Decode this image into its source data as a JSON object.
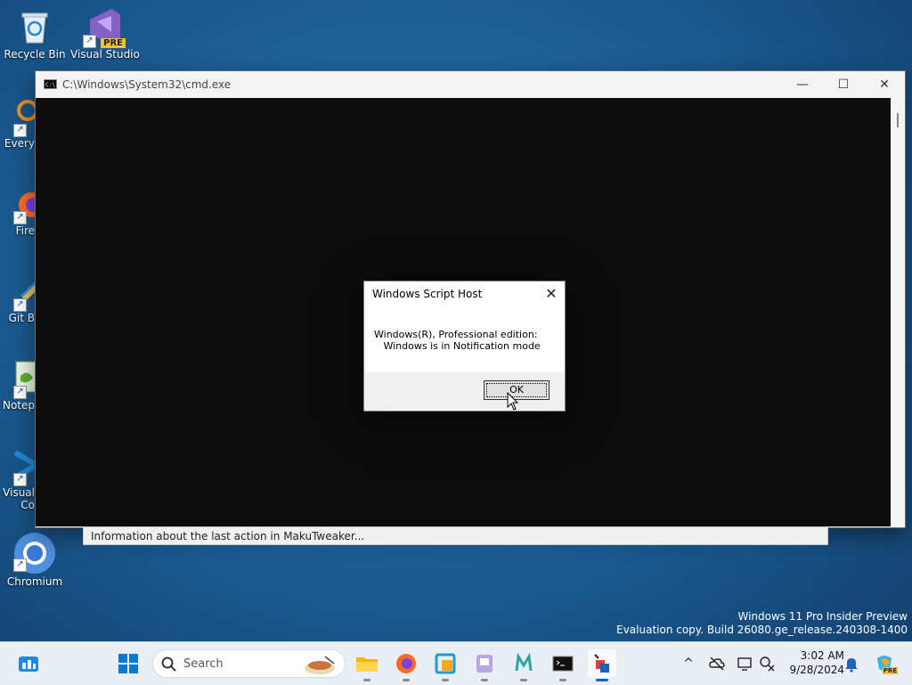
{
  "desktop": {
    "icons": [
      {
        "label": "Recycle Bin"
      },
      {
        "label": "Visual Studio",
        "badge": "PRE"
      },
      {
        "label": "Every"
      },
      {
        "label": "Fire"
      },
      {
        "label": "Git B"
      },
      {
        "label": "Notep"
      },
      {
        "label": "Visual",
        "label2": "Co"
      },
      {
        "label": "Chromium"
      }
    ]
  },
  "cmd": {
    "title": "C:\\Windows\\System32\\cmd.exe",
    "icon_text": "C:\\",
    "controls": {
      "minimize": "—",
      "maximize": "☐",
      "close": "✕"
    }
  },
  "status": {
    "text": "Information about the last action in MakuTweaker..."
  },
  "dialog": {
    "title": "Windows Script Host",
    "close": "✕",
    "message_line1": "Windows(R), Professional edition:",
    "message_line2": "   Windows is in Notification mode",
    "ok": "OK"
  },
  "watermark": {
    "line1": "Windows 11 Pro Insider Preview",
    "line2": "Evaluation copy. Build 26080.ge_release.240308-1400"
  },
  "taskbar": {
    "search_label": "Search",
    "tray_chevron": "^",
    "time": "3:02 AM",
    "date": "9/28/2024",
    "copilot_badge": "PRE",
    "colors": {
      "accent": "#0067c0",
      "taskbar_bg": "#e9eef4"
    }
  }
}
